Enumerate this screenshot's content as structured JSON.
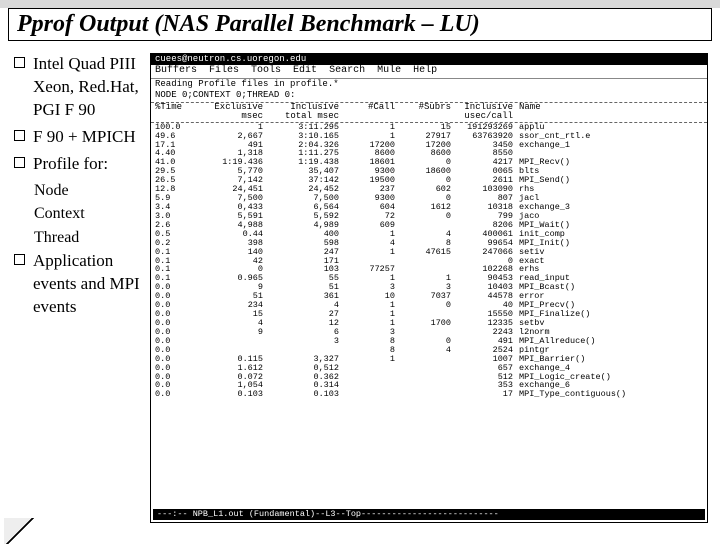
{
  "title": "Pprof Output (NAS Parallel Benchmark – LU)",
  "bullets": {
    "b1": "Intel Quad PIII Xeon, Red.Hat, PGI F 90",
    "b2": "F 90 + MPICH",
    "b3": "Profile for:",
    "b3s1": "Node",
    "b3s2": "Context",
    "b3s3": "Thread",
    "b4": "Application events and MPI events"
  },
  "terminal": {
    "title": "cuees@neutron.cs.uoregon.edu",
    "menu": {
      "m1": "Buffers",
      "m2": "Files",
      "m3": "Tools",
      "m4": "Edit",
      "m5": "Search",
      "m6": "Mule",
      "m7": "Help"
    },
    "msg": "Reading Profile files in profile.*",
    "hdr": "NODE 0;CONTEXT 0;THREAD 0:",
    "colnames": {
      "c0": "%Time",
      "c1": "Exclusive msec",
      "c2": "Inclusive total msec",
      "c3": "#Call",
      "c4": "#Subrs",
      "c5": "Inclusive usec/call",
      "c6": "Name"
    },
    "status": "---:-- NPB_L1.out      (Fundamental)--L3--Top---------------------------"
  },
  "chart_data": {
    "type": "table",
    "columns": [
      "%Time",
      "Exclusive msec",
      "Inclusive total msec",
      "#Call",
      "#Subrs",
      "Inclusive usec/call",
      "Name"
    ],
    "rows": [
      [
        "100.0",
        "1",
        "3:11.295",
        "1",
        "15",
        "191293269",
        "applu"
      ],
      [
        "49.6",
        "2,667",
        "3:10.165",
        "1",
        "27917",
        "63763920",
        "ssor_cnt_rtl.e"
      ],
      [
        "17.1",
        "491",
        "2:04.326",
        "17200",
        "17200",
        "3450",
        "exchange_1"
      ],
      [
        "4.40",
        "1,318",
        "1:11.275",
        "8600",
        "8600",
        "8550",
        ""
      ],
      [
        "41.0",
        "1:19.436",
        "1:19.438",
        "18601",
        "0",
        "4217",
        "MPI_Recv()"
      ],
      [
        "29.5",
        "5,770",
        "35,407",
        "9300",
        "18600",
        "0065",
        "blts"
      ],
      [
        "26.5",
        "7,142",
        "37:142",
        "19500",
        "0",
        "2611",
        "MPI_Send()"
      ],
      [
        "12.8",
        "24,451",
        "24,452",
        "237",
        "602",
        "103090",
        "rhs"
      ],
      [
        "5.9",
        "7,500",
        "7,500",
        "9300",
        "0",
        "807",
        "jacl"
      ],
      [
        "3.4",
        "0,433",
        "6,564",
        "604",
        "1612",
        "10318",
        "exchange_3"
      ],
      [
        "3.0",
        "5,591",
        "5,592",
        "72",
        "0",
        "799",
        "jaco"
      ],
      [
        "2.6",
        "4,988",
        "4,989",
        "609",
        "",
        "8206",
        "MPI_Wait()"
      ],
      [
        "0.5",
        "0.44",
        "400",
        "1",
        "4",
        "400061",
        "init_comp"
      ],
      [
        "0.2",
        "398",
        "598",
        "4",
        "8",
        "99654",
        "MPI_Init()"
      ],
      [
        "0.1",
        "140",
        "247",
        "1",
        "47615",
        "247066",
        "setiv"
      ],
      [
        "0.1",
        "42",
        "171",
        "",
        "",
        "0",
        "exact"
      ],
      [
        "0.1",
        "0",
        "103",
        "77257",
        "",
        "102268",
        "erhs"
      ],
      [
        "0.1",
        "0.965",
        "55",
        "1",
        "1",
        "90453",
        "read_input"
      ],
      [
        "0.0",
        "9",
        "51",
        "3",
        "3",
        "10403",
        "MPI_Bcast()"
      ],
      [
        "0.0",
        "51",
        "361",
        "10",
        "7037",
        "44578",
        "error"
      ],
      [
        "0.0",
        "234",
        "4",
        "1",
        "0",
        "40",
        "MPI_Precv()"
      ],
      [
        "0.0",
        "15",
        "27",
        "1",
        "",
        "15550",
        "MPI_Finalize()"
      ],
      [
        "0.0",
        "4",
        "12",
        "1",
        "1700",
        "12335",
        "setbv"
      ],
      [
        "0.0",
        "9",
        "6",
        "3",
        "",
        "2243",
        "l2norm"
      ],
      [
        "0.0",
        "",
        "3",
        "8",
        "0",
        "491",
        "MPI_Allreduce()"
      ],
      [
        "0.0",
        "",
        "",
        "8",
        "4",
        "2524",
        "pintgr"
      ],
      [
        "0.0",
        "0.115",
        "3,327",
        "1",
        "",
        "1007",
        "MPI_Barrier()"
      ],
      [
        "0.0",
        "1.612",
        "0,512",
        "",
        "",
        "657",
        "exchange_4"
      ],
      [
        "0.0",
        "0.072",
        "0.362",
        "",
        "",
        "512",
        "MPI_Logic_create()"
      ],
      [
        "0.0",
        "1,054",
        "0.314",
        "",
        "",
        "353",
        "exchange_6"
      ],
      [
        "0.0",
        "0.103",
        "0.103",
        "",
        "",
        "17",
        "MPI_Type_contiguous()"
      ]
    ]
  }
}
